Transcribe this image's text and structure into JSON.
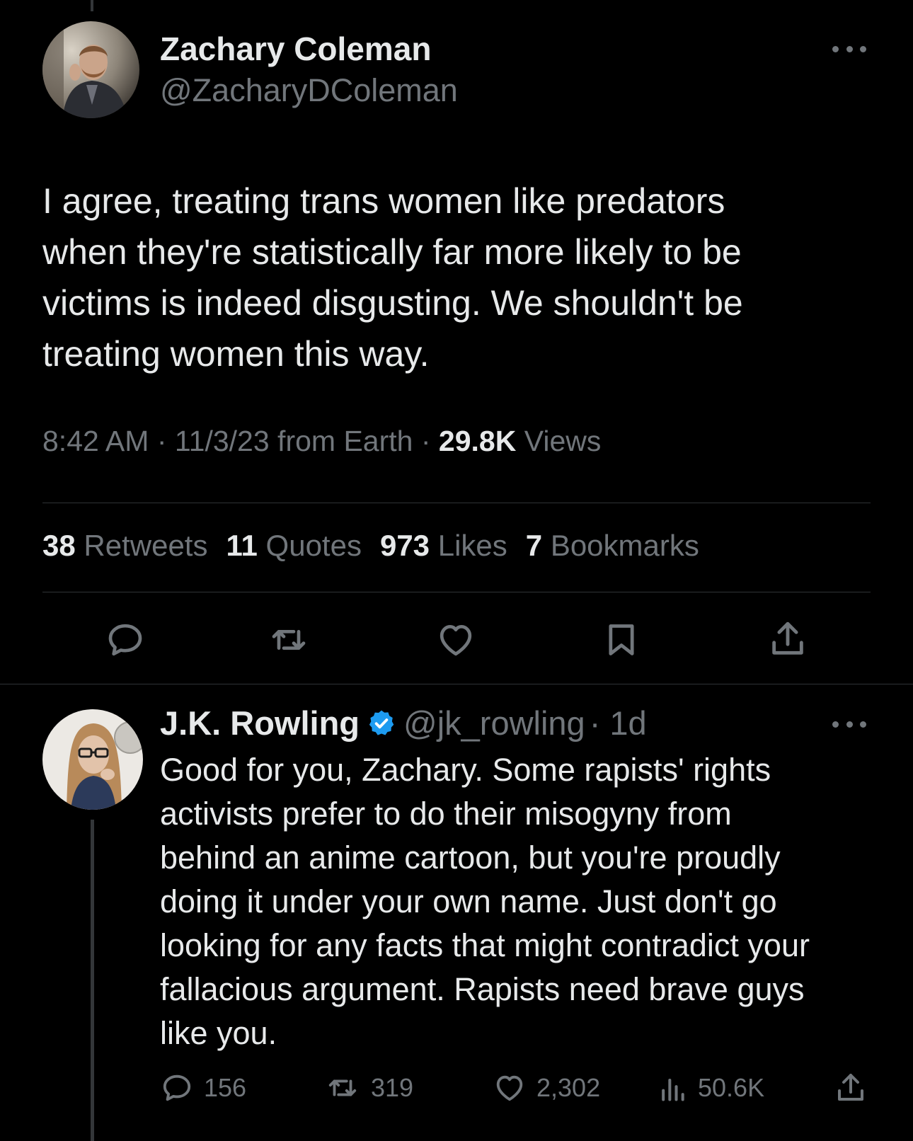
{
  "original_tweet": {
    "author_name": "Zachary Coleman",
    "author_handle": "@ZacharyDColeman",
    "text": "I agree, treating trans women like predators\nwhen they're statistically far more likely to be\nvictims is indeed disgusting. We shouldn't be\ntreating women this way.",
    "time": "8:42 AM",
    "date_source": "11/3/23 from Earth",
    "separator": "·",
    "views_count": "29.8K",
    "views_label": "Views",
    "stats": [
      {
        "count": "38",
        "label": "Retweets"
      },
      {
        "count": "11",
        "label": "Quotes"
      },
      {
        "count": "973",
        "label": "Likes"
      },
      {
        "count": "7",
        "label": "Bookmarks"
      }
    ],
    "actions": [
      "reply-icon",
      "retweet-icon",
      "like-icon",
      "bookmark-icon",
      "share-icon"
    ]
  },
  "reply_tweet": {
    "author_name": "J.K. Rowling",
    "verified": true,
    "author_handle": "@jk_rowling",
    "time_ago": "· 1d",
    "text": "Good for you, Zachary. Some rapists' rights\nactivists prefer to do their misogyny from\nbehind an anime cartoon, but you're proudly\ndoing it under your own name. Just don't go\nlooking for any facts that might contradict your\nfallacious argument. Rapists need brave guys\nlike you.",
    "actions": {
      "replies": "156",
      "retweets": "319",
      "likes": "2,302",
      "views": "50.6K"
    }
  },
  "colors": {
    "background": "#000000",
    "text_primary": "#e7e9ea",
    "text_secondary": "#71767b",
    "divider": "#2f3336",
    "verified_blue": "#1d9bf0"
  }
}
